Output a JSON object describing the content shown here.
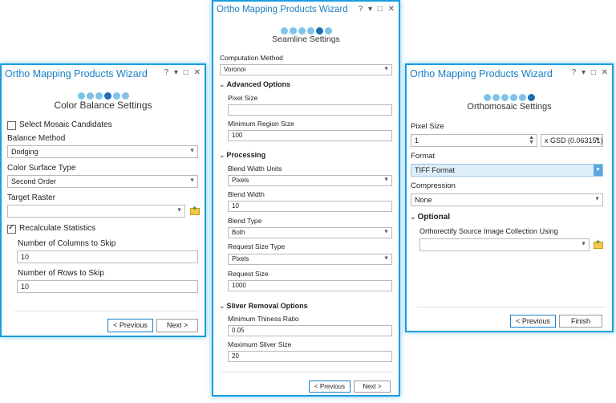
{
  "common": {
    "title": "Ortho Mapping Products Wizard",
    "ctrl_help": "?",
    "ctrl_pin": "▾",
    "ctrl_restore": "□",
    "ctrl_close": "✕"
  },
  "color_balance": {
    "step_title": "Color Balance Settings",
    "active_step": 4,
    "select_mosaic_label": "Select Mosaic Candidates",
    "select_mosaic_checked": false,
    "balance_method_label": "Balance Method",
    "balance_method_value": "Dodging",
    "color_surface_label": "Color Surface Type",
    "color_surface_value": "Second Order",
    "target_raster_label": "Target Raster",
    "target_raster_value": "",
    "recalc_label": "Recalculate Statistics",
    "recalc_checked": true,
    "cols_skip_label": "Number of Columns to Skip",
    "cols_skip_value": "10",
    "rows_skip_label": "Number of Rows to Skip",
    "rows_skip_value": "10",
    "previous_label": "< Previous",
    "next_label": "Next >"
  },
  "seamline": {
    "step_title": "Seamline Settings",
    "active_step": 5,
    "computation_label": "Computation Method",
    "computation_value": "Voronoi",
    "advanced_label": "Advanced Options",
    "pixel_size_label": "Pixel Size",
    "pixel_size_value": "",
    "min_region_label": "Minimum Region Size",
    "min_region_value": "100",
    "processing_label": "Processing",
    "blend_units_label": "Blend Width Units",
    "blend_units_value": "Pixels",
    "blend_width_label": "Blend Width",
    "blend_width_value": "10",
    "blend_type_label": "Blend Type",
    "blend_type_value": "Both",
    "request_type_label": "Request Size Type",
    "request_type_value": "Pixels",
    "request_size_label": "Request Size",
    "request_size_value": "1000",
    "sliver_label": "Sliver Removal Options",
    "min_thin_label": "Minimum Thiness Ratio",
    "min_thin_value": "0.05",
    "max_sliver_label": "Maximum Sliver Size",
    "max_sliver_value": "20",
    "previous_label": "< Previous",
    "next_label": "Next >"
  },
  "orthomosaic": {
    "step_title": "Orthomosaic Settings",
    "active_step": 6,
    "pixel_size_label": "Pixel Size",
    "pixel_size_value": "1",
    "gsd_value": "x GSD (0.063151)",
    "format_label": "Format",
    "format_value": "TIFF Format",
    "compression_label": "Compression",
    "compression_value": "None",
    "optional_label": "Optional",
    "orthorectify_label": "Orthorectify Source Image Collection Using",
    "orthorectify_value": "",
    "previous_label": "< Previous",
    "finish_label": "Finish"
  }
}
